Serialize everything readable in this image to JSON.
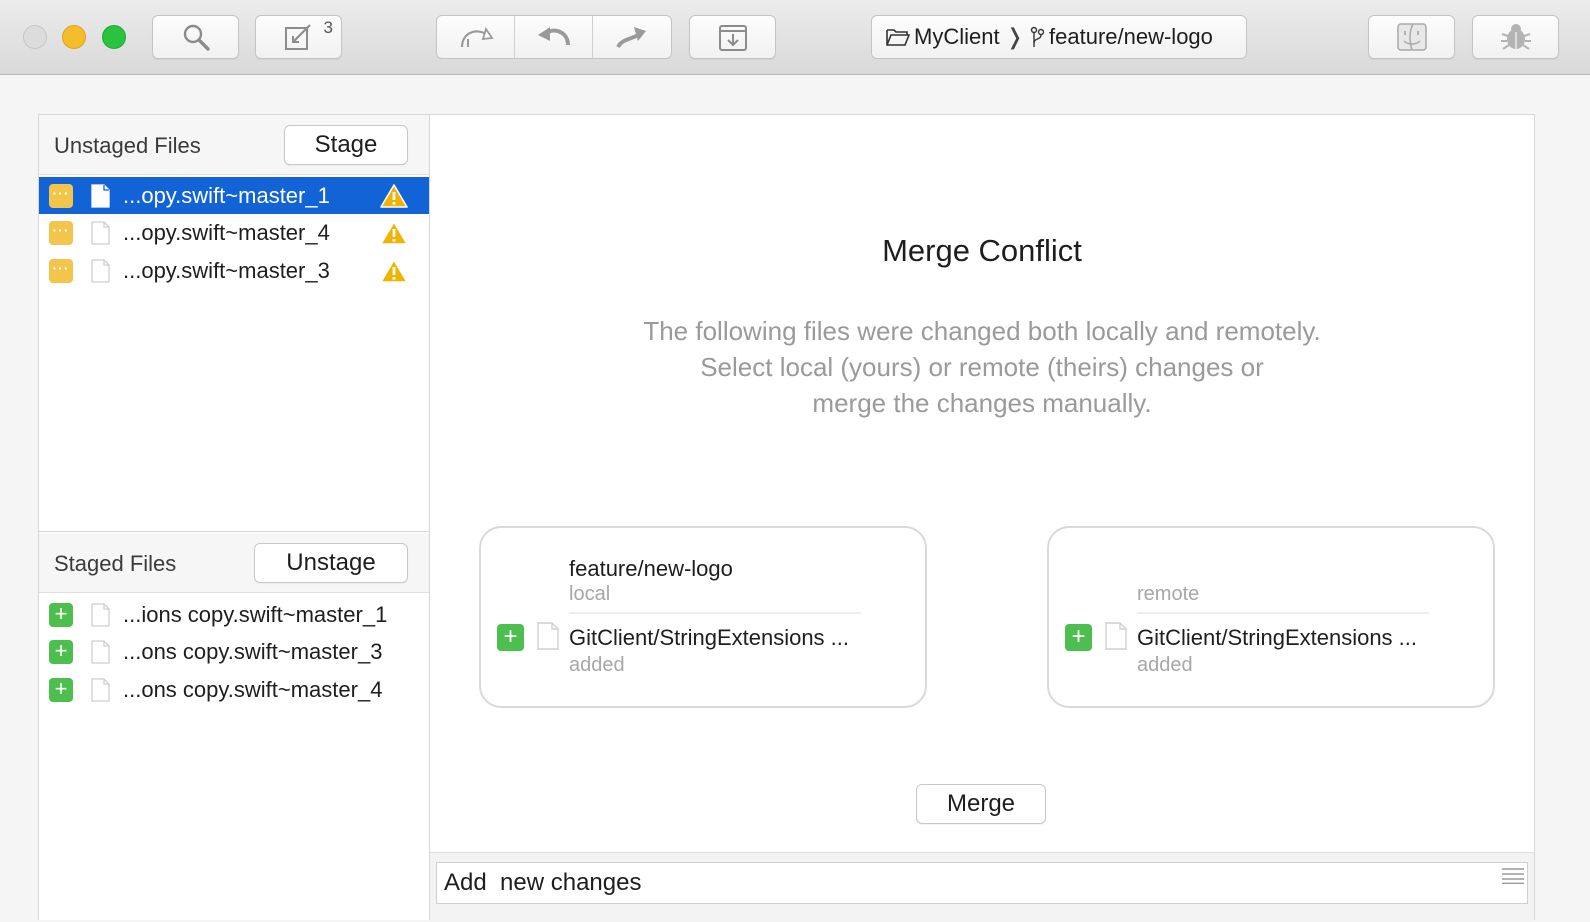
{
  "toolbar": {
    "commit_badge": "3",
    "repo_name": "MyClient",
    "branch_name": "feature/new-logo",
    "icons": [
      "search-icon",
      "commit-edit-icon",
      "pull-icon",
      "undo-icon",
      "push-icon",
      "download-icon",
      "finder-icon",
      "bug-icon"
    ]
  },
  "unstaged": {
    "title": "Unstaged Files",
    "button_label": "Stage",
    "files": [
      {
        "name": "...opy.swift~master_1",
        "status": "conflict",
        "warning": true,
        "selected": true
      },
      {
        "name": "...opy.swift~master_4",
        "status": "conflict",
        "warning": true,
        "selected": false
      },
      {
        "name": "...opy.swift~master_3",
        "status": "conflict",
        "warning": true,
        "selected": false
      }
    ]
  },
  "staged": {
    "title": "Staged Files",
    "button_label": "Unstage",
    "files": [
      {
        "name": "...ions copy.swift~master_1",
        "status": "added"
      },
      {
        "name": "...ons copy.swift~master_3",
        "status": "added"
      },
      {
        "name": "...ons copy.swift~master_4",
        "status": "added"
      }
    ]
  },
  "merge": {
    "title": "Merge Conflict",
    "description_lines": [
      "The following files were changed both locally and remotely.",
      "Select local (yours) or remote (theirs) changes or",
      "merge the changes manually."
    ],
    "local": {
      "branch": "feature/new-logo",
      "side": "local",
      "file": "GitClient/StringExtensions ...",
      "state": "added"
    },
    "remote": {
      "branch": "",
      "side": "remote",
      "file": "GitClient/StringExtensions ...",
      "state": "added"
    },
    "merge_button": "Merge"
  },
  "commit": {
    "message": "Add  new changes"
  },
  "colors": {
    "selection": "#1264d6",
    "conflict": "#f3c54a",
    "added": "#4cbf4f",
    "warning": "#f0b400"
  }
}
